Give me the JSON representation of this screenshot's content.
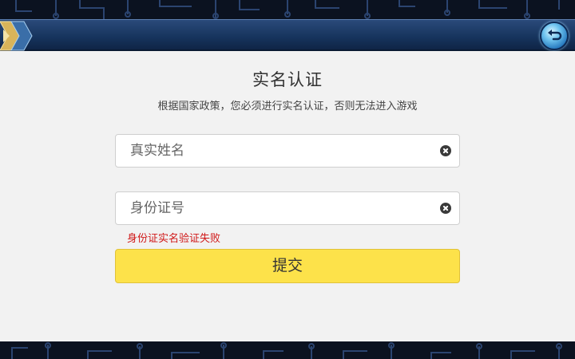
{
  "dialog": {
    "title": "实名认证",
    "subtitle": "根据国家政策，您必须进行实名认证，否则无法进入游戏"
  },
  "form": {
    "name_field": {
      "placeholder": "真实姓名",
      "value": ""
    },
    "id_field": {
      "placeholder": "身份证号",
      "value": ""
    },
    "error_message": "身份证实名验证失败",
    "submit_label": "提交"
  },
  "colors": {
    "header": "#16335c",
    "panel_bg": "#f2f2f2",
    "submit_bg": "#fde24a",
    "error_text": "#d01818"
  },
  "icons": {
    "back": "back-arrow-icon",
    "clear": "clear-icon"
  }
}
